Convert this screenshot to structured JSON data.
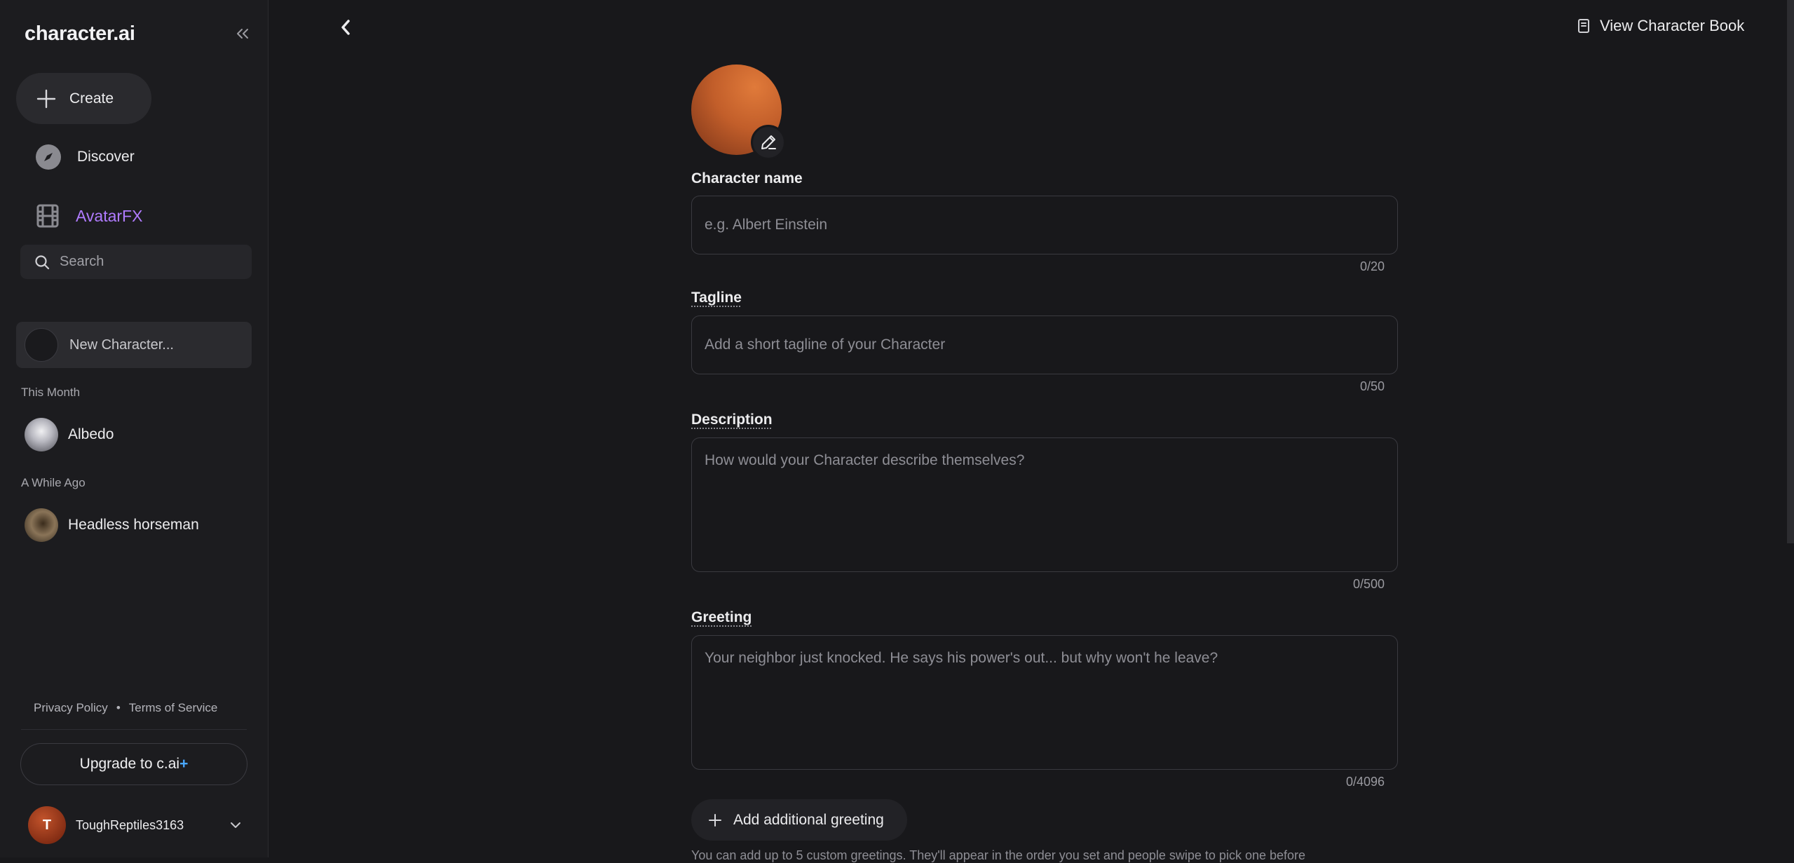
{
  "sidebar": {
    "logo": "character.ai",
    "create_label": "Create",
    "nav": [
      {
        "label": "Discover",
        "icon": "compass-icon"
      },
      {
        "label": "AvatarFX",
        "icon": "film-icon",
        "color": "#b07bff"
      }
    ],
    "search_placeholder": "Search",
    "new_character_label": "New Character...",
    "sections": [
      {
        "title": "This Month",
        "items": [
          {
            "name": "Albedo"
          }
        ]
      },
      {
        "title": "A While Ago",
        "items": [
          {
            "name": "Headless horseman"
          }
        ]
      }
    ],
    "footer": {
      "privacy": "Privacy Policy",
      "separator": "•",
      "terms": "Terms of Service"
    },
    "upgrade_label": "Upgrade to c.ai",
    "upgrade_plus": "+",
    "user": {
      "initial": "T",
      "name": "ToughReptiles3163"
    }
  },
  "header": {
    "view_book_label": "View Character Book"
  },
  "form": {
    "name": {
      "label": "Character name",
      "placeholder": "e.g. Albert Einstein",
      "counter": "0/20"
    },
    "tagline": {
      "label": "Tagline",
      "placeholder": "Add a short tagline of your Character",
      "counter": "0/50"
    },
    "description": {
      "label": "Description",
      "placeholder": "How would your Character describe themselves?",
      "counter": "0/500"
    },
    "greeting": {
      "label": "Greeting",
      "placeholder": "Your neighbor just knocked. He says his power's out... but why won't he leave?",
      "counter": "0/4096"
    },
    "add_greeting_label": "Add additional greeting",
    "help_text": "You can add up to 5 custom greetings. They'll appear in the order you set and people swipe to pick one before"
  },
  "colors": {
    "accent": "#b07bff",
    "plus": "#4aa8ff",
    "background": "#18181b"
  }
}
